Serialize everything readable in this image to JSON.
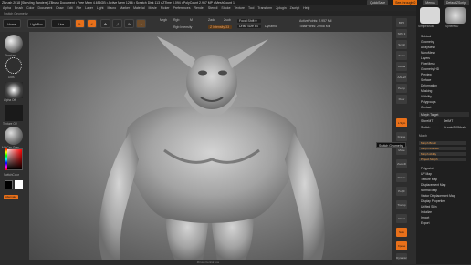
{
  "titlebar": {
    "text": "ZBrush 2018 [Sterviing Sanders]   ZBrush Document   • Free Mem 4.656GB • Active Mem 1266 • Scratch Disk 113 • ZTime 0.094 • PolyCount 2.957 MP • MeshCount 1",
    "quicksave": "QuickSave",
    "seethrough": "See-through 0",
    "menus": "Menus",
    "default_script": "DefaultZScript"
  },
  "menubar": [
    "Alpha",
    "Brush",
    "Color",
    "Document",
    "Draw",
    "Edit",
    "File",
    "Layer",
    "Light",
    "Macro",
    "Marker",
    "Material",
    "Movie",
    "Picker",
    "Preferences",
    "Render",
    "Stencil",
    "Stroke",
    "Texture",
    "Tool",
    "Transform",
    "Zplugin",
    "Zscript",
    "Help"
  ],
  "infobar": "Switch Geometry",
  "toolbar": {
    "home_page": "Home Page",
    "lightbox": "LightBox",
    "live_boolean": "Live Boolean",
    "edit": "Edit",
    "draw": "Draw",
    "move": "Move",
    "scale": "Scale",
    "rotate": "Rotate",
    "mrgb": "Mrgb",
    "rgb": "Rgb",
    "m": "M",
    "zadd": "Zadd",
    "zsub": "Zsub",
    "zcut": "Zcut",
    "rgb_intensity": "Rgb Intensity",
    "z_intensity": "Z Intensity 33",
    "focal_shift": "Focal Shift 0",
    "draw_size": "Draw Size 64",
    "dynamic": "Dynamic",
    "active_points": "ActivePoints: 2.957 Mil",
    "total_points": "TotalPoints: 2.958 Mil"
  },
  "leftshelf": {
    "brush": "Standard",
    "stroke": "Dots",
    "alpha": "Alpha Off",
    "texture": "Texture Off",
    "material": "MatCap Gray",
    "gradient": "Gradient",
    "switch_color": "SwitchColor",
    "alternate": "Alternate"
  },
  "right_icons": [
    "BPR",
    "SPix 3",
    "Scroll",
    "Zoom",
    "Actual",
    "AAHalf",
    "Persp",
    "Floor",
    "L.Sym",
    "Frame",
    "Move",
    "ZoomD",
    "Rotate",
    "PolyF",
    "Transp",
    "Ghost",
    "Solo",
    "Xpose",
    "Dynamic"
  ],
  "rpanel": {
    "top_labels": [
      "SimpleBrush",
      "Sphere3D"
    ],
    "items": [
      "Subtool",
      "Geometry",
      "ArrayMesh",
      "NanoMesh",
      "Layers",
      "FiberMesh",
      "Geometry HD",
      "Preview",
      "Surface",
      "Deformation",
      "Masking",
      "Visibility",
      "Polygroups",
      "Contact",
      "Morph Target"
    ],
    "storemt": "StoreMT",
    "delmt": "DelMT",
    "switch": "Switch",
    "creatediffmesh": "CreateDiffMesh",
    "morph_label": "Morph",
    "sliders": [
      "Morph Brush",
      "Morph Modifier",
      "Morph Ability",
      "Project Morph"
    ],
    "items2": [
      "Polypaint",
      "UV Map",
      "Texture Map",
      "Displacement Map",
      "Normal Map",
      "Vector Displacement Map",
      "Display Properties",
      "Unified Skin",
      "Initialize",
      "Import",
      "Export"
    ]
  },
  "tooltip": "Switch Geometry",
  "bottombar": "Zbrush Central Live"
}
